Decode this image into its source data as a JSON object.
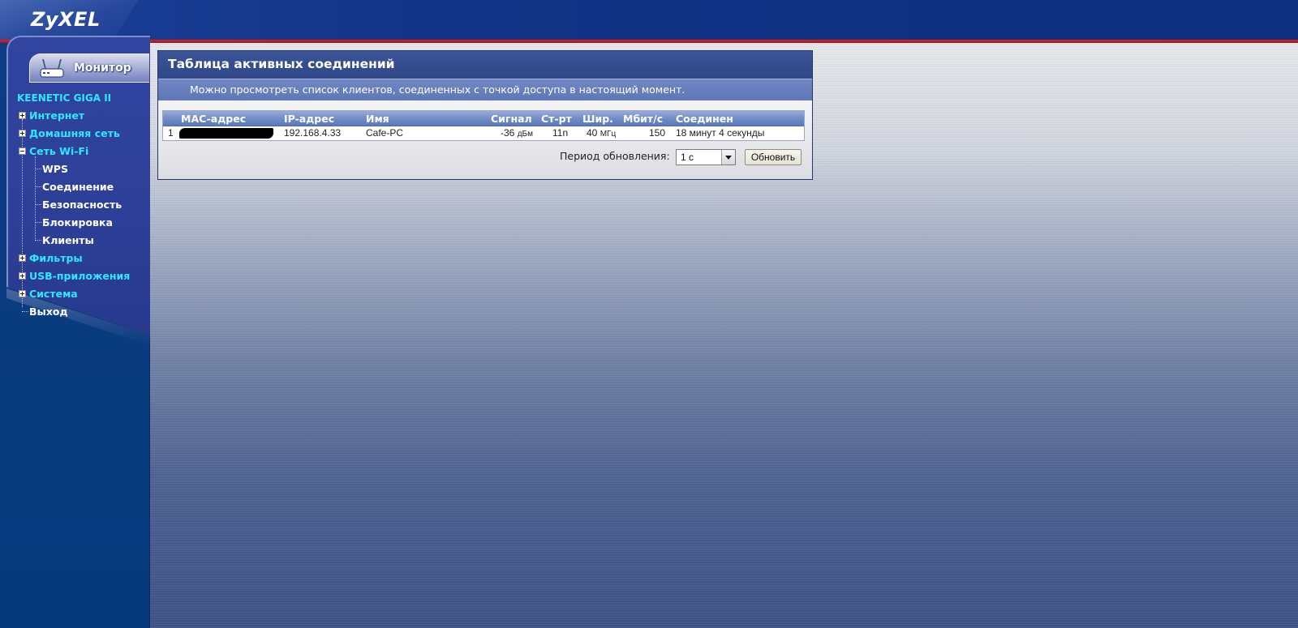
{
  "header": {
    "logo": "ZyXEL"
  },
  "sidebar": {
    "monitor_label": "Монитор",
    "device_title": "KEENETIC GIGA II",
    "items": [
      {
        "label": "Интернет",
        "expander": "plus"
      },
      {
        "label": "Домашняя сеть",
        "expander": "plus"
      },
      {
        "label": "Сеть Wi-Fi",
        "expander": "minus"
      },
      {
        "label": "WPS"
      },
      {
        "label": "Соединение"
      },
      {
        "label": "Безопасность"
      },
      {
        "label": "Блокировка"
      },
      {
        "label": "Клиенты"
      },
      {
        "label": "Фильтры",
        "expander": "plus"
      },
      {
        "label": "USB-приложения",
        "expander": "plus"
      },
      {
        "label": "Система",
        "expander": "plus"
      },
      {
        "label": "Выход"
      }
    ]
  },
  "panel": {
    "title": "Таблица активных соединений",
    "description": "Можно просмотреть список клиентов, соединенных с точкой доступа в настоящий момент."
  },
  "table": {
    "headers": {
      "mac": "MAC-адрес",
      "ip": "IP-адрес",
      "name": "Имя",
      "signal": "Сигнал",
      "standard": "Ст-рт",
      "width": "Шир.",
      "rate": "Мбит/с",
      "connected": "Соединен"
    },
    "rows": [
      {
        "index": "1",
        "ip": "192.168.4.33",
        "name": "Cafe-PC",
        "signal_value": "-36",
        "signal_unit": "дБм",
        "standard": "11n",
        "width_value": "40",
        "width_unit": "МГц",
        "rate": "150",
        "connected": "18 минут 4 секунды"
      }
    ]
  },
  "refresh": {
    "label": "Период обновления:",
    "selected": "1 с",
    "button": "Обновить"
  },
  "colors": {
    "header_blue": "#123486",
    "accent_red": "#d1232a",
    "nav_cyan": "#2ee8ff",
    "panel_title": "#2f4788"
  }
}
